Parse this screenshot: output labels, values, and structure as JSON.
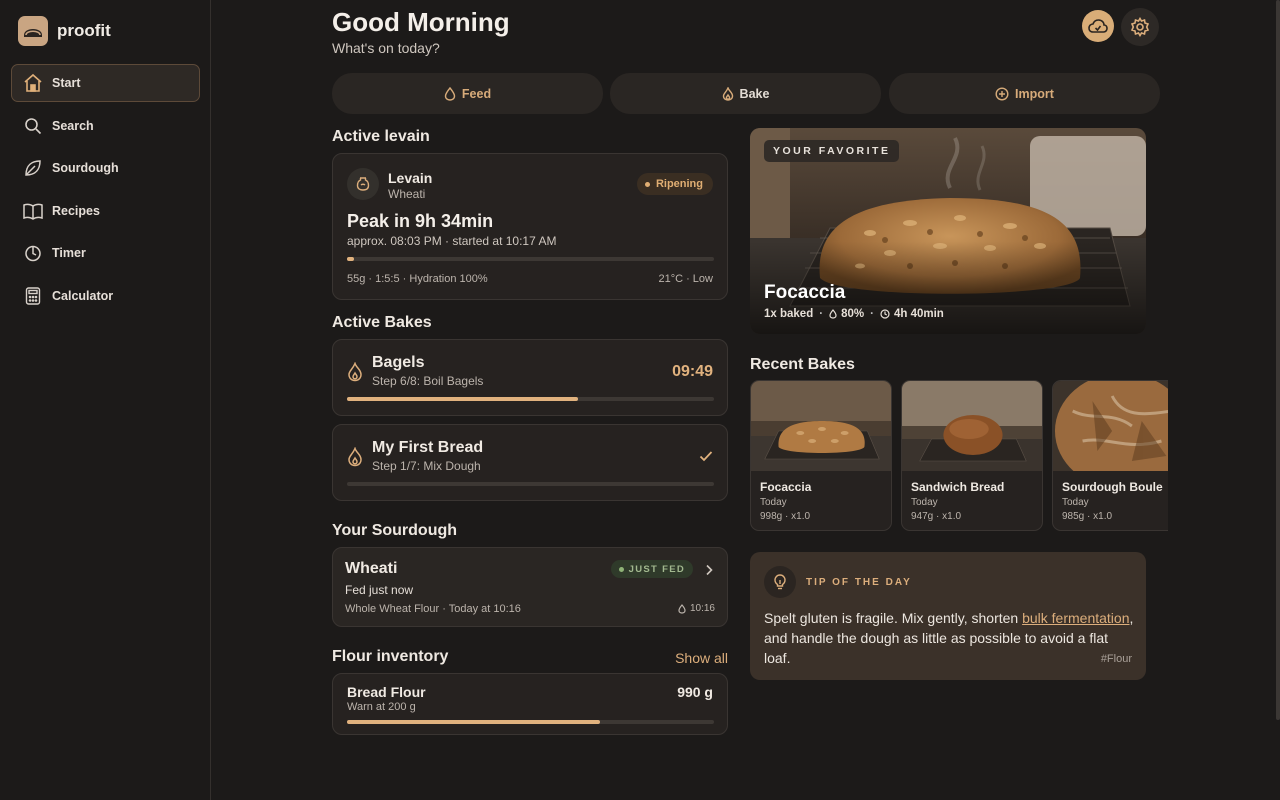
{
  "app": {
    "name": "proofit"
  },
  "sidebar": {
    "items": [
      {
        "label": "Start",
        "icon": "home-icon",
        "active": true
      },
      {
        "label": "Search",
        "icon": "search-icon"
      },
      {
        "label": "Sourdough",
        "icon": "leaf-icon"
      },
      {
        "label": "Recipes",
        "icon": "book-icon"
      },
      {
        "label": "Timer",
        "icon": "timer-icon"
      },
      {
        "label": "Calculator",
        "icon": "calculator-icon"
      }
    ]
  },
  "header": {
    "greeting": "Good Morning",
    "subtitle": "What's on today?",
    "actions": {
      "feed": "Feed",
      "bake": "Bake",
      "import": "Import"
    }
  },
  "levain": {
    "section_title": "Active levain",
    "name": "Levain",
    "starter": "Wheati",
    "status": "Ripening",
    "peak": "Peak in 9h 34min",
    "approx": "approx. 08:03 PM · started at 10:17 AM",
    "progress": 0.02,
    "details": "55g · 1:5:5 · Hydration 100%",
    "conditions": "21°C · Low"
  },
  "active_bakes": {
    "section_title": "Active Bakes",
    "items": [
      {
        "name": "Bagels",
        "step": "Step 6/8: Boil Bagels",
        "timer": "09:49",
        "progress": 0.63
      },
      {
        "name": "My First Bread",
        "step": "Step 1/7: Mix Dough",
        "timer": "",
        "progress": 0.0
      }
    ]
  },
  "sourdough": {
    "section_title": "Your Sourdough",
    "name": "Wheati",
    "badge": "JUST FED",
    "fed": "Fed just now",
    "details": "Whole Wheat Flour · Today at 10:16",
    "time": "10:16"
  },
  "flour": {
    "section_title": "Flour inventory",
    "show_all": "Show all",
    "name": "Bread Flour",
    "warn": "Warn at 200 g",
    "amount": "990 g",
    "level": 0.69
  },
  "favorite": {
    "tag": "YOUR FAVORITE",
    "title": "Focaccia",
    "baked": "1x baked",
    "hydration": "80%",
    "duration": "4h 40min"
  },
  "recent_bakes": {
    "section_title": "Recent Bakes",
    "items": [
      {
        "name": "Focaccia",
        "date": "Today",
        "meta": "998g · x1.0"
      },
      {
        "name": "Sandwich Bread",
        "date": "Today",
        "meta": "947g · x1.0"
      },
      {
        "name": "Sourdough Boule",
        "date": "Today",
        "meta": "985g · x1.0"
      }
    ]
  },
  "tip": {
    "label": "TIP OF THE DAY",
    "text_before": "Spelt gluten is fragile. Mix gently, shorten ",
    "link": "bulk fermentation",
    "text_after": ", and handle the dough as little as possible to avoid a flat loaf.",
    "tag": "#Flour"
  },
  "colors": {
    "accent": "#e1b27e",
    "background": "#1c1a19",
    "card": "#262220",
    "tip": "#3b3129"
  }
}
